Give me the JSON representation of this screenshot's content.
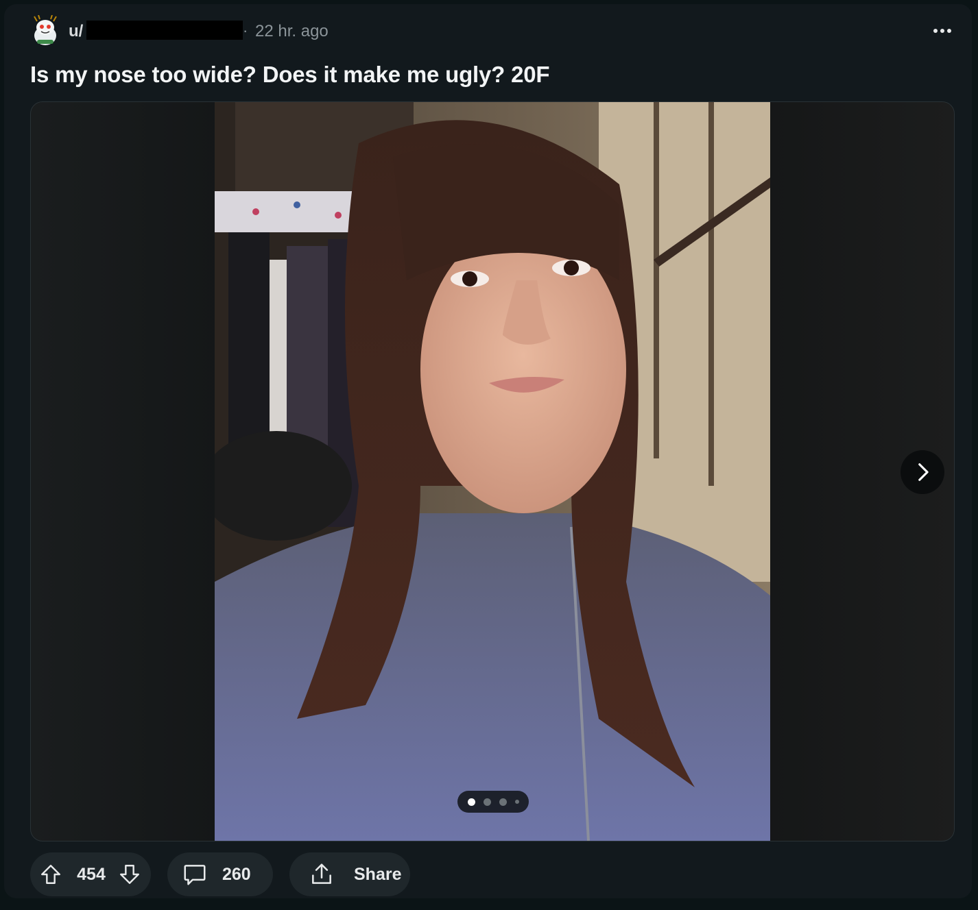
{
  "post": {
    "user_prefix": "u/",
    "separator": "·",
    "timestamp": "22 hr. ago",
    "title": "Is my nose too wide? Does it make me ugly? 20F"
  },
  "media": {
    "pages_total": 4,
    "current_page": 1,
    "next_icon": "chevron-right-icon"
  },
  "actions": {
    "vote_count": "454",
    "comment_count": "260",
    "share_label": "Share"
  },
  "icons": {
    "more": "more-horizontal-icon",
    "upvote": "arrow-up-icon",
    "downvote": "arrow-down-icon",
    "comment": "comment-bubble-icon",
    "share": "share-upload-icon"
  },
  "colors": {
    "background": "#0b1416",
    "card": "#12191d",
    "pill": "#1f272b",
    "text": "#f2f4f5",
    "muted": "#8b9499"
  }
}
